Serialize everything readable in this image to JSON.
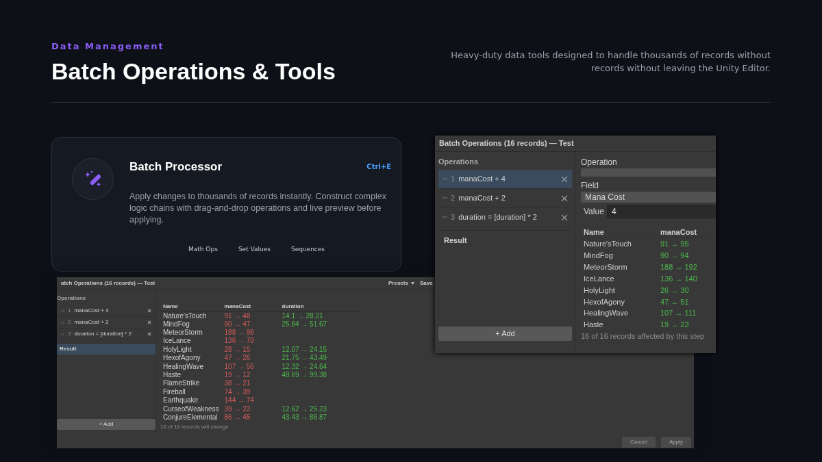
{
  "header": {
    "eyebrow": "Data Management",
    "title": "Batch Operations & Tools",
    "subtitle": "Heavy-duty data tools designed to handle thousands of records without records without leaving the Unity Editor."
  },
  "feature_card": {
    "title": "Batch Processor",
    "shortcut": "Ctrl+E",
    "description": "Apply changes to thousands of records instantly. Construct complex logic chains with drag-and-drop operations and live preview before applying.",
    "tags": [
      "Math Ops",
      "Set Values",
      "Sequences"
    ]
  },
  "back_window": {
    "title": "atch Operations (16 records) — Test",
    "toolbar": [
      {
        "label": "Presets",
        "dropdown": true
      },
      {
        "label": "Save"
      }
    ],
    "operations_label": "Operations",
    "operations": [
      {
        "number": "1",
        "text": "manaCost + 4",
        "selected": false
      },
      {
        "number": "2",
        "text": "manaCost + 2",
        "selected": false
      },
      {
        "number": "3",
        "text": "duration = [duration] * 2",
        "selected": false
      }
    ],
    "result": {
      "label": "Result",
      "selected": true
    },
    "add_button": "+ Add",
    "table": {
      "columns": [
        {
          "label": "Name"
        },
        {
          "label": "manaCost",
          "color": "#d65a5a"
        },
        {
          "label": "duration",
          "color": "#4cb84c"
        }
      ],
      "rows": [
        {
          "name": "Nature'sTouch",
          "mana": "91 → 48",
          "duration": "14.1 → 28.21"
        },
        {
          "name": "MindFog",
          "mana": "90 → 47",
          "duration": "25.84 → 51.67"
        },
        {
          "name": "MeteorStorm",
          "mana": "188 → 96"
        },
        {
          "name": "IceLance",
          "mana": "136 → 70"
        },
        {
          "name": "HolyLight",
          "mana": "28 → 15",
          "duration": "12.07 → 24.15"
        },
        {
          "name": "HexofAgony",
          "mana": "47 → 26",
          "duration": "21.75 → 43.49"
        },
        {
          "name": "HealingWave",
          "mana": "107 → 56",
          "duration": "12.32 → 24.64"
        },
        {
          "name": "Haste",
          "mana": "19 → 12",
          "duration": "49.69 → 99.38"
        },
        {
          "name": "FlameStrike",
          "mana": "38 → 21"
        },
        {
          "name": "Fireball",
          "mana": "74 → 39"
        },
        {
          "name": "Earthquake",
          "mana": "144 → 74"
        },
        {
          "name": "CurseofWeakness",
          "mana": "39 → 22",
          "duration": "12.62 → 25.23"
        },
        {
          "name": "ConjureElemental",
          "mana": "86 → 45",
          "duration": "43.43 → 86.87"
        }
      ]
    },
    "footer": "16 of 16 records will change",
    "buttons": [
      "Cancel",
      "Apply"
    ]
  },
  "front_window": {
    "title": "Batch Operations (16 records) — Test",
    "operations_label": "Operations",
    "operations": [
      {
        "number": "1",
        "text": "manaCost + 4",
        "selected": true
      },
      {
        "number": "2",
        "text": "manaCost + 2",
        "selected": false
      },
      {
        "number": "3",
        "text": "duration = [duration] * 2",
        "selected": false
      }
    ],
    "result": {
      "label": "Result",
      "selected": false
    },
    "add_button": "+ Add",
    "editor": {
      "operation_label": "Operation",
      "field_label": "Field",
      "field_value": "Mana Cost",
      "value_label": "Value",
      "value": "4"
    },
    "table": {
      "columns": [
        {
          "label": "Name"
        },
        {
          "label": "manaCost",
          "color": "#4cb84c"
        }
      ],
      "rows": [
        {
          "name": "Nature'sTouch",
          "mana": "91 → 95"
        },
        {
          "name": "MindFog",
          "mana": "90 → 94"
        },
        {
          "name": "MeteorStorm",
          "mana": "188 → 192"
        },
        {
          "name": "IceLance",
          "mana": "136 → 140"
        },
        {
          "name": "HolyLight",
          "mana": "26 → 30"
        },
        {
          "name": "HexofAgony",
          "mana": "47 → 51"
        },
        {
          "name": "HealingWave",
          "mana": "107 → 111"
        },
        {
          "name": "Haste",
          "mana": "19 → 23"
        }
      ]
    },
    "footer": "16 of 16 records affected by this step"
  }
}
